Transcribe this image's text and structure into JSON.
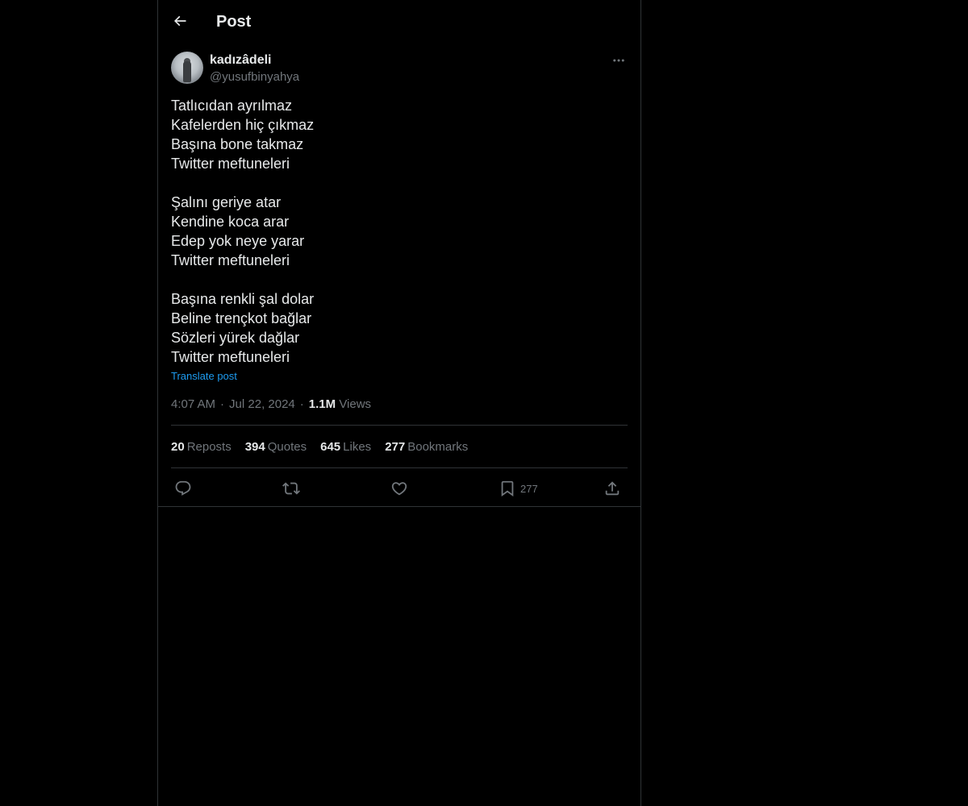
{
  "header": {
    "back_icon": "arrow-left-icon",
    "title": "Post"
  },
  "author": {
    "display_name": "kadızâdeli",
    "handle": "@yusufbinyahya",
    "more_icon": "more-horizontal-icon"
  },
  "post": {
    "lines": [
      "Tatlıcıdan ayrılmaz",
      "Kafelerden hiç çıkmaz",
      "Başına bone takmaz",
      "Twitter meftuneleri",
      "",
      "Şalını geriye atar",
      "Kendine koca arar",
      "Edep yok neye yarar",
      "Twitter meftuneleri",
      "",
      "Başına renkli şal dolar",
      "Beline trençkot bağlar",
      "Sözleri yürek dağlar",
      "Twitter meftuneleri"
    ],
    "translate_label": "Translate post",
    "time": "4:07 AM",
    "date": "Jul 22, 2024",
    "views_count": "1.1M",
    "views_label": "Views"
  },
  "stats": {
    "reposts": {
      "count": "20",
      "label": "Reposts"
    },
    "quotes": {
      "count": "394",
      "label": "Quotes"
    },
    "likes": {
      "count": "645",
      "label": "Likes"
    },
    "bookmarks": {
      "count": "277",
      "label": "Bookmarks"
    }
  },
  "actions": {
    "reply_icon": "reply-icon",
    "repost_icon": "repost-icon",
    "like_icon": "heart-icon",
    "bookmark_icon": "bookmark-icon",
    "bookmark_count": "277",
    "share_icon": "share-icon"
  },
  "colors": {
    "background": "#000000",
    "text_primary": "#e7e9ea",
    "text_secondary": "#71767b",
    "accent": "#1d9bf0",
    "border": "#2f3336"
  }
}
